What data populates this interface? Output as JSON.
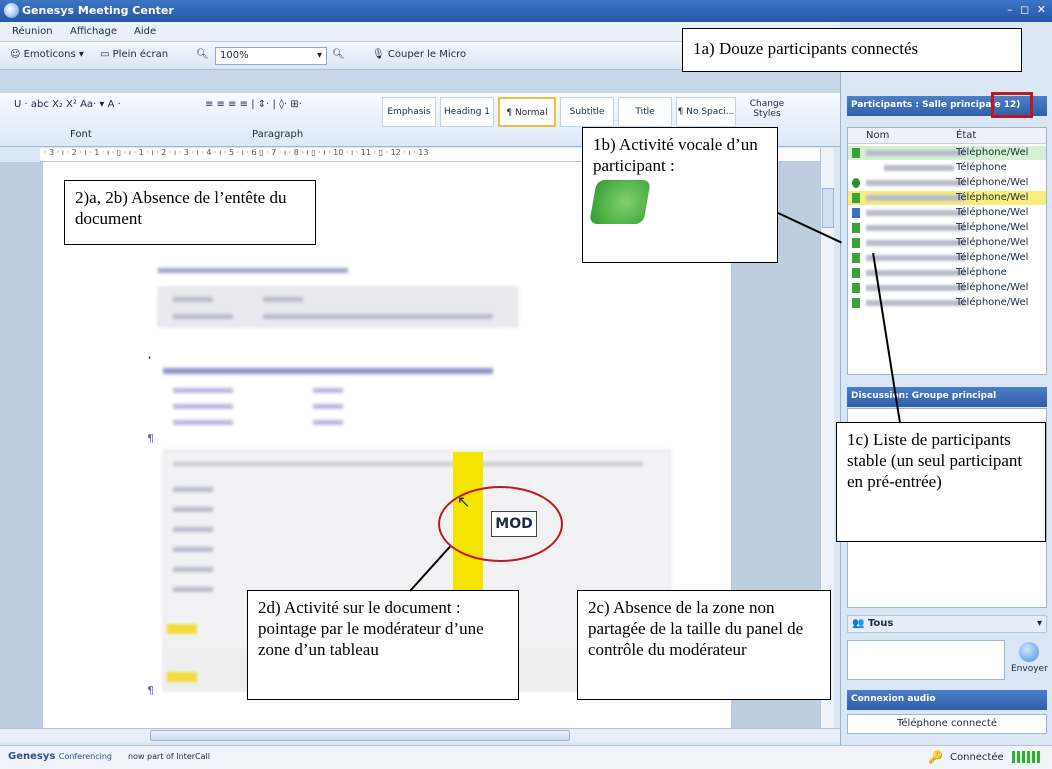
{
  "window": {
    "title": "Genesys Meeting Center"
  },
  "menu": [
    "Réunion",
    "Affichage",
    "Aide"
  ],
  "toolbar": {
    "emoticons": "Emoticons",
    "fullscreen": "Plein écran",
    "zoom": "100%",
    "mute": "Couper le Micro"
  },
  "ribbon": {
    "font_group": "Font",
    "paragraph_group": "Paragraph",
    "styles": [
      "Emphasis",
      "Heading 1",
      "¶ Normal",
      "Subtitle",
      "Title",
      "¶ No Spaci..."
    ],
    "change_styles": "Change Styles"
  },
  "ruler": "· 3 · ı · 2 · ı · 1 · ı · ▯ · ı · 1 · ı · 2 · ı · 3 · ı · 4 · ı · 5 · ı · 6 ▯ · 7 · ı · 8 · ı ▯ · ı · 10 · ı · 11 · ▯ · 12 · ı · 13",
  "document": {
    "pointer_label": "MOD"
  },
  "participants": {
    "header": "Participants : Salle principale",
    "count": "12)",
    "col_name": "Nom",
    "col_state": "État",
    "rows": [
      {
        "state": "Téléphone/Wel"
      },
      {
        "state": "Téléphone"
      },
      {
        "state": "Téléphone/Wel"
      },
      {
        "state": "Téléphone/Wel"
      },
      {
        "state": "Téléphone/Wel"
      },
      {
        "state": "Téléphone/Wel"
      },
      {
        "state": "Téléphone/Wel"
      },
      {
        "state": "Téléphone/Wel"
      },
      {
        "state": "Téléphone"
      },
      {
        "state": "Téléphone/Wel"
      },
      {
        "state": "Téléphone/Wel"
      }
    ]
  },
  "chat": {
    "header": "Discussion: Groupe principal",
    "recipient": "Tous",
    "send": "Envoyer"
  },
  "audio": {
    "header": "Connexion audio",
    "status": "Téléphone connecté"
  },
  "status": {
    "brand": "Genesys",
    "brand_sub": "Conferencing",
    "brand_note": "now part of InterCall",
    "connected": "Connectée"
  },
  "callouts": {
    "c1a": "1a) Douze  participants connectés",
    "c1b": "1b) Activité vocale d’un participant :",
    "c1c": "1c) Liste de participants stable (un seul participant en pré-entrée)",
    "c2a": "2)a, 2b) Absence de l’entête du document",
    "c2c": "2c) Absence de la zone non partagée de la taille du panel de contrôle du modérateur",
    "c2d": "2d) Activité sur le document : pointage par le modérateur d’une zone d’un tableau"
  },
  "colors": {
    "accent": "#2f5fa8",
    "highlight": "#f5e400",
    "callout_red": "#c0171f"
  }
}
